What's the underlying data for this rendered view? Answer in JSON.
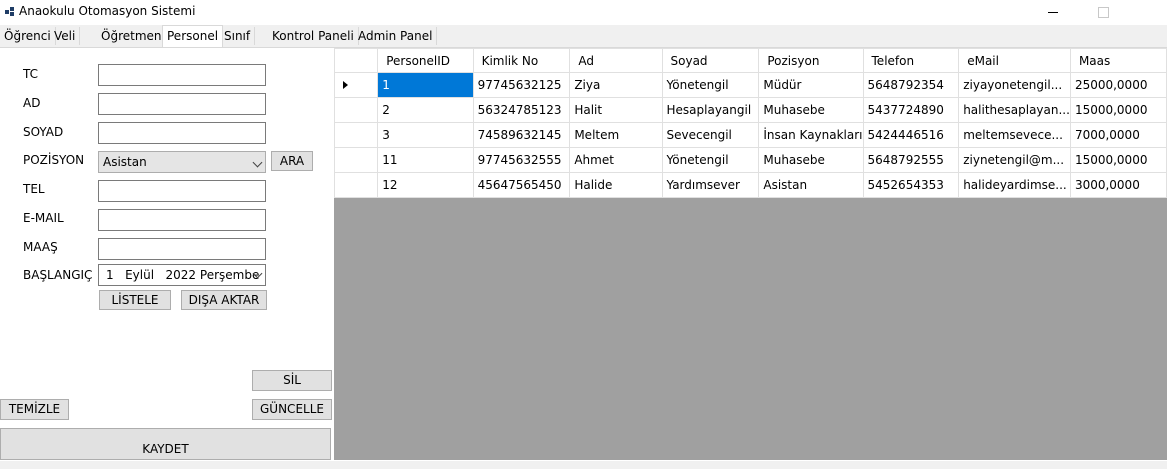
{
  "window": {
    "title": "Anaokulu Otomasyon Sistemi",
    "icon": "app-grid-icon",
    "controls": [
      "minimize-icon",
      "maximize-icon"
    ]
  },
  "tabs": [
    "Öğrenci",
    "Veli",
    "Öğretmen",
    "Personel",
    "Sınıf",
    "Kontrol Paneli",
    "Admin Panel"
  ],
  "active_tab": "Personel",
  "form": {
    "labels": {
      "tc": "TC",
      "ad": "AD",
      "soyad": "SOYAD",
      "pozisyon": "POZİSYON",
      "tel": "TEL",
      "email": "E-MAIL",
      "maas": "MAAŞ",
      "baslangic": "BAŞLANGIÇ"
    },
    "values": {
      "tc": "",
      "ad": "",
      "soyad": "",
      "tel": "",
      "email": "",
      "maas": ""
    },
    "pozisyon_selected": "Asistan",
    "date": {
      "day": "1",
      "month": "Eylül",
      "year": "2022",
      "weekday": "Perşembe"
    }
  },
  "buttons": {
    "ara": "ARA",
    "listele": "LİSTELE",
    "disa_aktar": "DIŞA AKTAR",
    "sil": "SİL",
    "temizle": "TEMİZLE",
    "guncelle": "GÜNCELLE",
    "kaydet": "KAYDET"
  },
  "grid": {
    "columns": [
      "PersonelID",
      "Kimlik No",
      "Ad",
      "Soyad",
      "Pozisyon",
      "Telefon",
      "eMail",
      "Maas"
    ],
    "rows": [
      [
        "1",
        "97745632125",
        "Ziya",
        "Yönetengil",
        "Müdür",
        "5648792354",
        "ziyayonetengil...",
        "25000,0000"
      ],
      [
        "2",
        "56324785123",
        "Halit",
        "Hesaplayangil",
        "Muhasebe",
        "5437724890",
        "halithesaplayan...",
        "15000,0000"
      ],
      [
        "3",
        "74589632145",
        "Meltem",
        "Sevecengil",
        "İnsan Kaynakları",
        "5424446516",
        "meltemsevece...",
        "7000,0000"
      ],
      [
        "11",
        "97745632555",
        "Ahmet",
        "Yönetengil",
        "Muhasebe",
        "5648792555",
        "ziynetengil@m...",
        "15000,0000"
      ],
      [
        "12",
        "45647565450",
        "Halide",
        "Yardımsever",
        "Asistan",
        "5452654353",
        "halideyardimse...",
        "3000,0000"
      ]
    ],
    "selected_row": 0,
    "colors": {
      "selection": "#0078d7",
      "empty_area": "#a0a0a0"
    }
  }
}
